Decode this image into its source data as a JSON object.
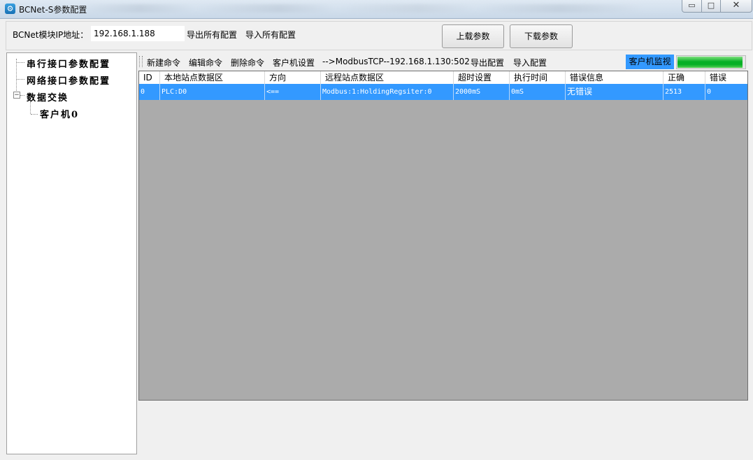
{
  "window": {
    "title": "BCNet-S参数配置",
    "minimize_glyph": "▭",
    "maximize_glyph": "□",
    "close_glyph": "✕"
  },
  "header": {
    "ip_label": "BCNet模块IP地址：",
    "ip_value": "192.168.1.188",
    "export_all": "导出所有配置",
    "import_all": "导入所有配置",
    "upload_button": "上载参数",
    "download_button": "下载参数"
  },
  "tree": {
    "items": [
      {
        "label": "串行接口参数配置"
      },
      {
        "label": "网络接口参数配置"
      },
      {
        "label": "数据交换"
      },
      {
        "label": "客户机0"
      }
    ],
    "expander_glyph": "−"
  },
  "toolbar": {
    "new_command": "新建命令",
    "edit_command": "编辑命令",
    "delete_command": "删除命令",
    "client_settings": "客户机设置",
    "connection": "-->ModbusTCP--192.168.1.130:502",
    "export_config": "导出配置",
    "import_config": "导入配置",
    "monitor_button": "客户机监视",
    "progress": 0.97
  },
  "grid": {
    "columns": [
      "ID",
      "本地站点数据区",
      "方向",
      "远程站点数据区",
      "超时设置",
      "执行时间",
      "错误信息",
      "正确",
      "错误"
    ],
    "rows": [
      [
        "0",
        "PLC:D0",
        "<==",
        "Modbus:1:HoldingRegsiter:0",
        "2000mS",
        "0mS",
        "无错误",
        "2513",
        "0"
      ]
    ]
  },
  "colors": {
    "selection": "#3399ff",
    "monitor_button": "#3399ff",
    "progress_green": "#06b025",
    "grid_background": "#ababab"
  }
}
